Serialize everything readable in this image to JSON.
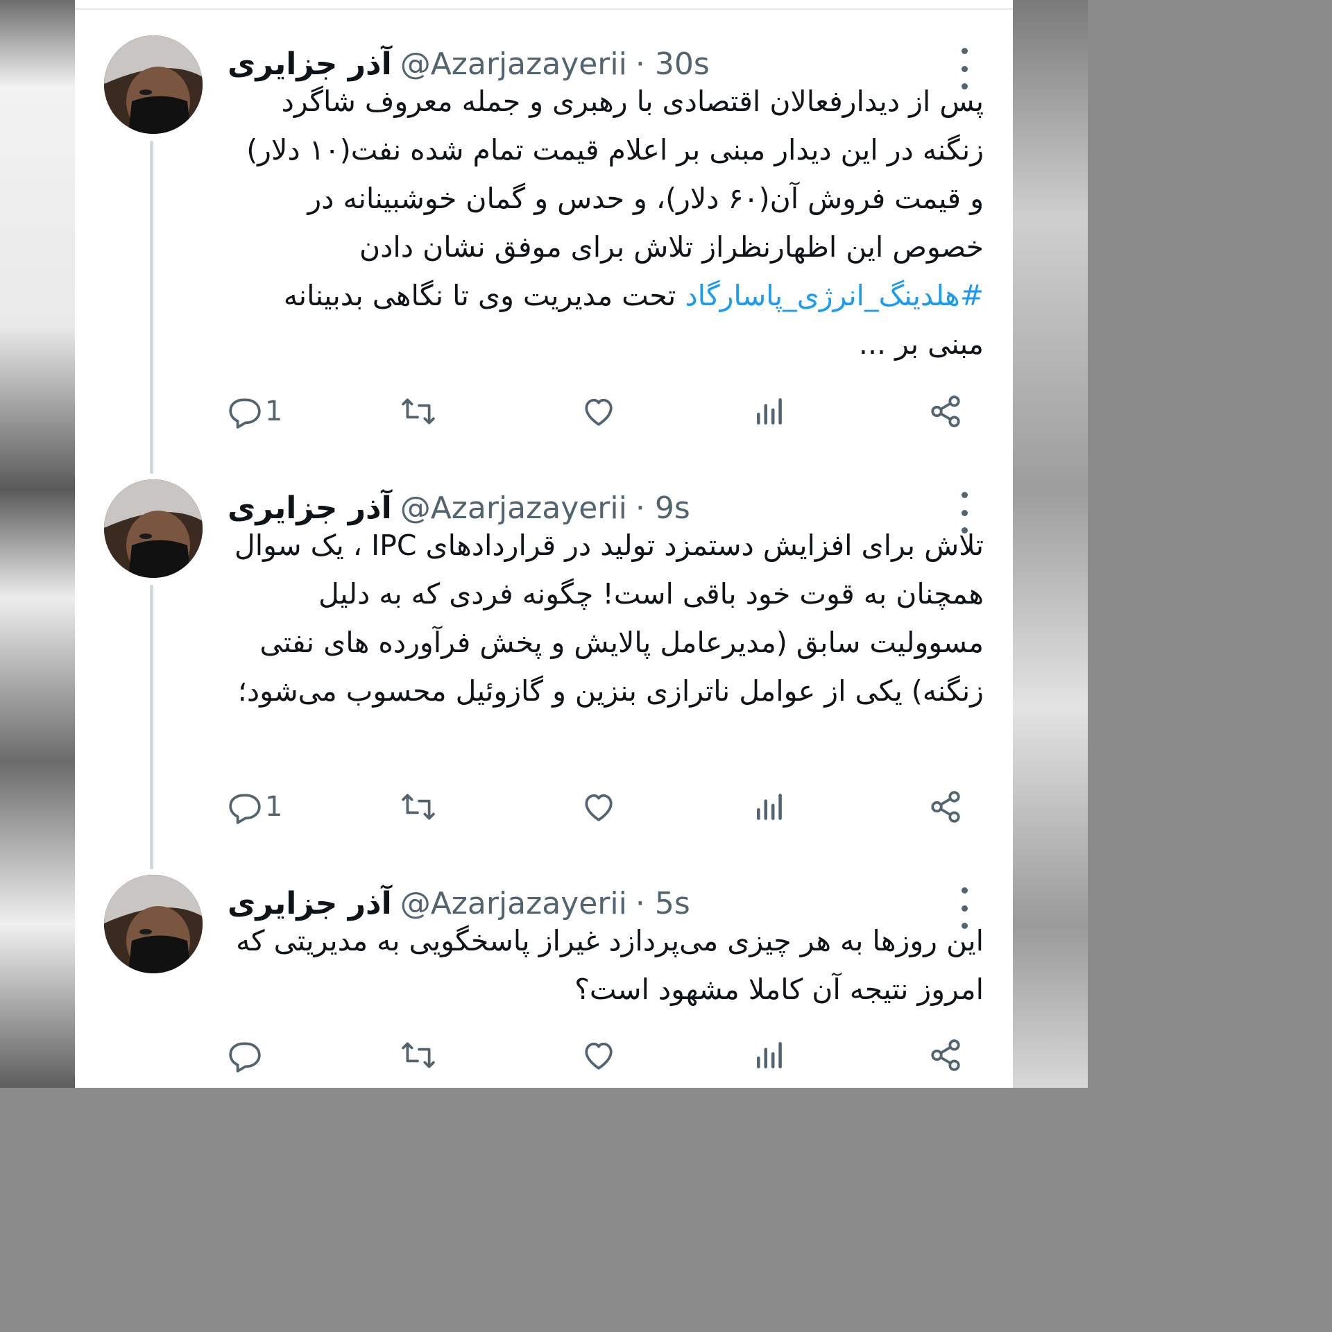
{
  "tweets": [
    {
      "name": "آذر جزایری",
      "handle": "@Azarjazayerii",
      "time": "· 30s",
      "text_before": "پس از دیدارفعالان اقتصادی با رهبری و جمله معروف شاگرد زنگنه در این دیدار مبنی بر اعلام قیمت تمام شده نفت(۱۰ دلار) و قیمت فروش آن(۶۰ دلار)، و حدس و گمان خوشبینانه در خصوص این اظهارنظراز تلاش برای موفق نشان دادن ",
      "hashtag": "#هلدینگ_انرژی_پاسارگاد",
      "text_after": " تحت مدیریت وی تا نگاهی بدبینانه مبنی بر ...",
      "reply_count": "1"
    },
    {
      "name": "آذر جزایری",
      "handle": "@Azarjazayerii",
      "time": "· 9s",
      "text": "تلاش برای افزایش دستمزد تولید در قراردادهای IPC ، یک سوال همچنان به قوت خود باقی است! چگونه فردی که به دلیل مسوولیت سابق (مدیرعامل پالایش و پخش فرآورده های نفتی زنگنه) یکی از عوامل ناترازی بنزین و گازوئیل محسوب می‌شود؛",
      "reply_count": "1"
    },
    {
      "name": "آذر جزایری",
      "handle": "@Azarjazayerii",
      "time": "· 5s",
      "text": "این روزها به هر چیزی می‌پردازد غیراز پاسخگویی به مدیریتی که امروز نتیجه آن کاملا مشهود است؟",
      "reply_count": ""
    }
  ],
  "icons": [
    "reply-icon",
    "retweet-icon",
    "like-icon",
    "views-icon",
    "share-icon",
    "more-icon"
  ],
  "colors": {
    "text": "#0f1419",
    "secondary": "#536471",
    "link": "#1d9bf0",
    "thread_line": "#cfd9de"
  }
}
